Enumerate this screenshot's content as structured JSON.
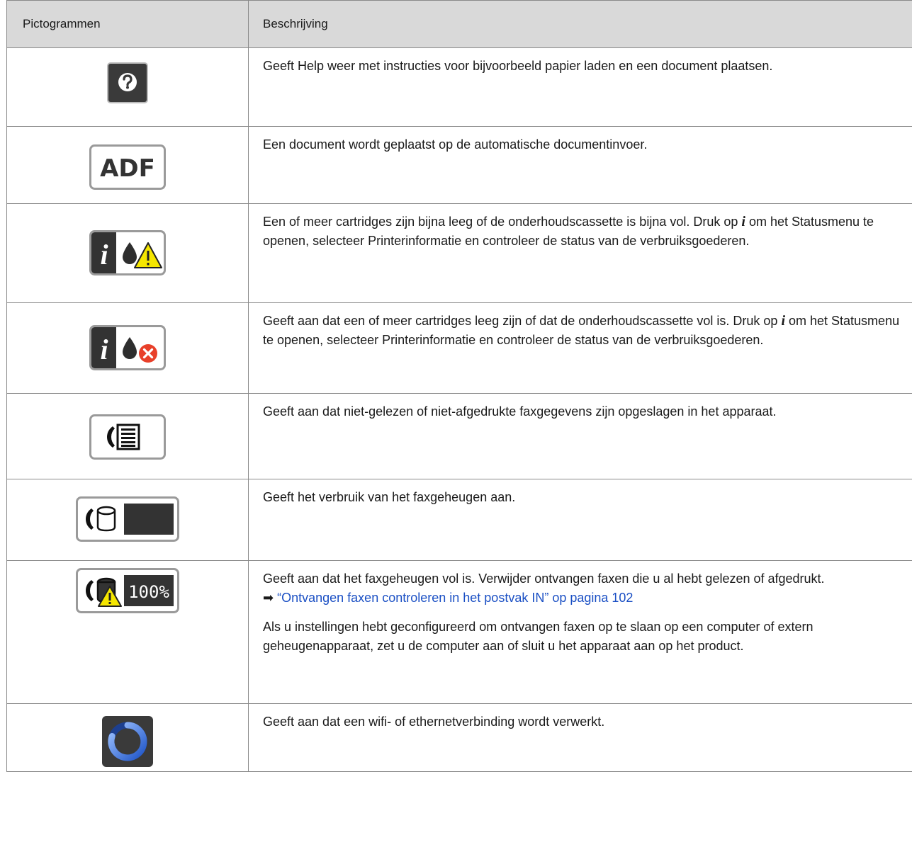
{
  "header": {
    "col_icons": "Pictogrammen",
    "col_desc": "Beschrijving"
  },
  "rows": [
    {
      "icon": "help-icon",
      "desc": "Geeft Help weer met instructies voor bijvoorbeeld papier laden en een document plaatsen."
    },
    {
      "icon": "adf-icon",
      "icon_text": "ADF",
      "desc": "Een document wordt geplaatst op de automatische documentinvoer."
    },
    {
      "icon": "ink-low-warning-icon",
      "desc_a": "Een of meer cartridges zijn bijna leeg of de onderhoudscassette is bijna vol. Druk op ",
      "desc_b": " om het Statusmenu te openen, selecteer Printerinformatie en controleer de status van de verbruiksgoederen."
    },
    {
      "icon": "ink-empty-error-icon",
      "desc_a": "Geeft aan dat een of meer cartridges leeg zijn of dat de onderhoudscassette vol is. Druk op ",
      "desc_b": " om het Statusmenu te openen, selecteer Printerinformatie en controleer de status van de verbruiksgoederen."
    },
    {
      "icon": "fax-data-icon",
      "desc": "Geeft aan dat niet-gelezen of niet-afgedrukte faxgegevens zijn opgeslagen in het apparaat."
    },
    {
      "icon": "fax-memory-usage-icon",
      "desc": "Geeft het verbruik van het faxgeheugen aan."
    },
    {
      "icon": "fax-memory-full-icon",
      "icon_text": "100%",
      "desc": "Geeft aan dat het faxgeheugen vol is. Verwijder ontvangen faxen die u al hebt gelezen of afgedrukt.",
      "link_arrow": "➡",
      "link_text": "“Ontvangen faxen controleren in het postvak IN” op pagina 102",
      "desc2": "Als u instellingen hebt geconfigureerd om ontvangen faxen op te slaan op een computer of extern geheugenapparaat, zet u de computer aan of sluit u het apparaat aan op het product."
    },
    {
      "icon": "network-processing-icon",
      "desc": "Geeft aan dat een wifi- of ethernetverbinding wordt verwerkt."
    }
  ],
  "info_glyph": "i",
  "colors": {
    "header_bg": "#d9d9d9",
    "link": "#1a4fc4",
    "icon_dark": "#333333",
    "warning_yellow": "#f5e600",
    "error_red": "#e8402a",
    "network_blue": "#2f6fe0"
  }
}
